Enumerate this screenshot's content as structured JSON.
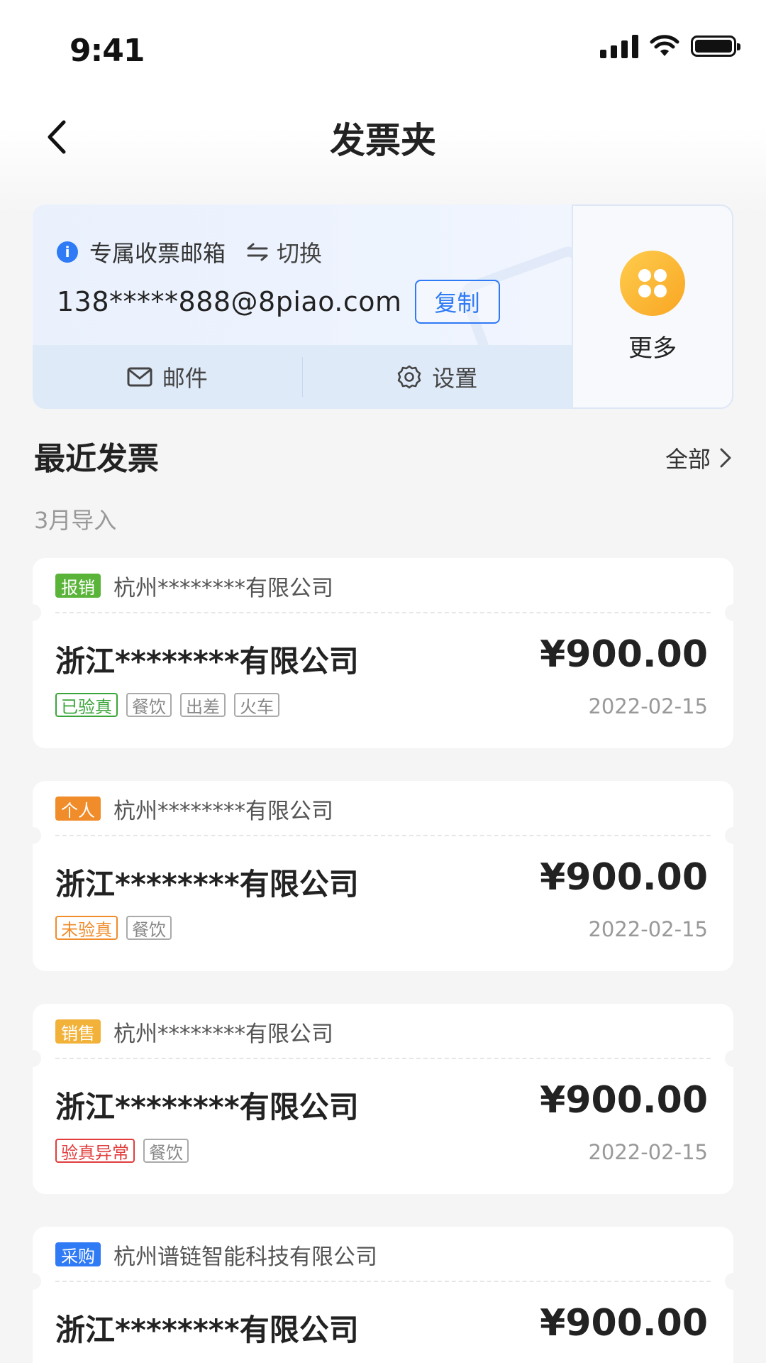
{
  "status_bar": {
    "time": "9:41"
  },
  "nav": {
    "title": "发票夹"
  },
  "mailbox": {
    "label": "专属收票邮箱",
    "switch_label": "切换",
    "email": "138*****888@8piao.com",
    "copy_label": "复制",
    "actions": [
      {
        "label": "邮件",
        "icon": "mail-icon"
      },
      {
        "label": "设置",
        "icon": "gear-icon"
      }
    ],
    "more_label": "更多",
    "colors": {
      "accent": "#2f7af5",
      "more_icon": "#f8a623"
    }
  },
  "recent": {
    "title": "最近发票",
    "all_label": "全部",
    "group_label": "3月导入"
  },
  "invoices": [
    {
      "category": "报销",
      "category_color": "#5ab43a",
      "seller": "杭州********有限公司",
      "buyer": "浙江********有限公司",
      "amount": "¥900.00",
      "date": "2022-02-15",
      "status": "已验真",
      "status_color": "#3aa63a",
      "tags": [
        "餐饮",
        "出差",
        "火车"
      ]
    },
    {
      "category": "个人",
      "category_color": "#f08c2a",
      "seller": "杭州********有限公司",
      "buyer": "浙江********有限公司",
      "amount": "¥900.00",
      "date": "2022-02-15",
      "status": "未验真",
      "status_color": "#f08c2a",
      "tags": [
        "餐饮"
      ]
    },
    {
      "category": "销售",
      "category_color": "#f2b23a",
      "seller": "杭州********有限公司",
      "buyer": "浙江********有限公司",
      "amount": "¥900.00",
      "date": "2022-02-15",
      "status": "验真异常",
      "status_color": "#e23c3c",
      "tags": [
        "餐饮"
      ]
    },
    {
      "category": "采购",
      "category_color": "#2f7af5",
      "seller": "杭州谱链智能科技有限公司",
      "buyer": "浙江********有限公司",
      "amount": "¥900.00"
    }
  ]
}
